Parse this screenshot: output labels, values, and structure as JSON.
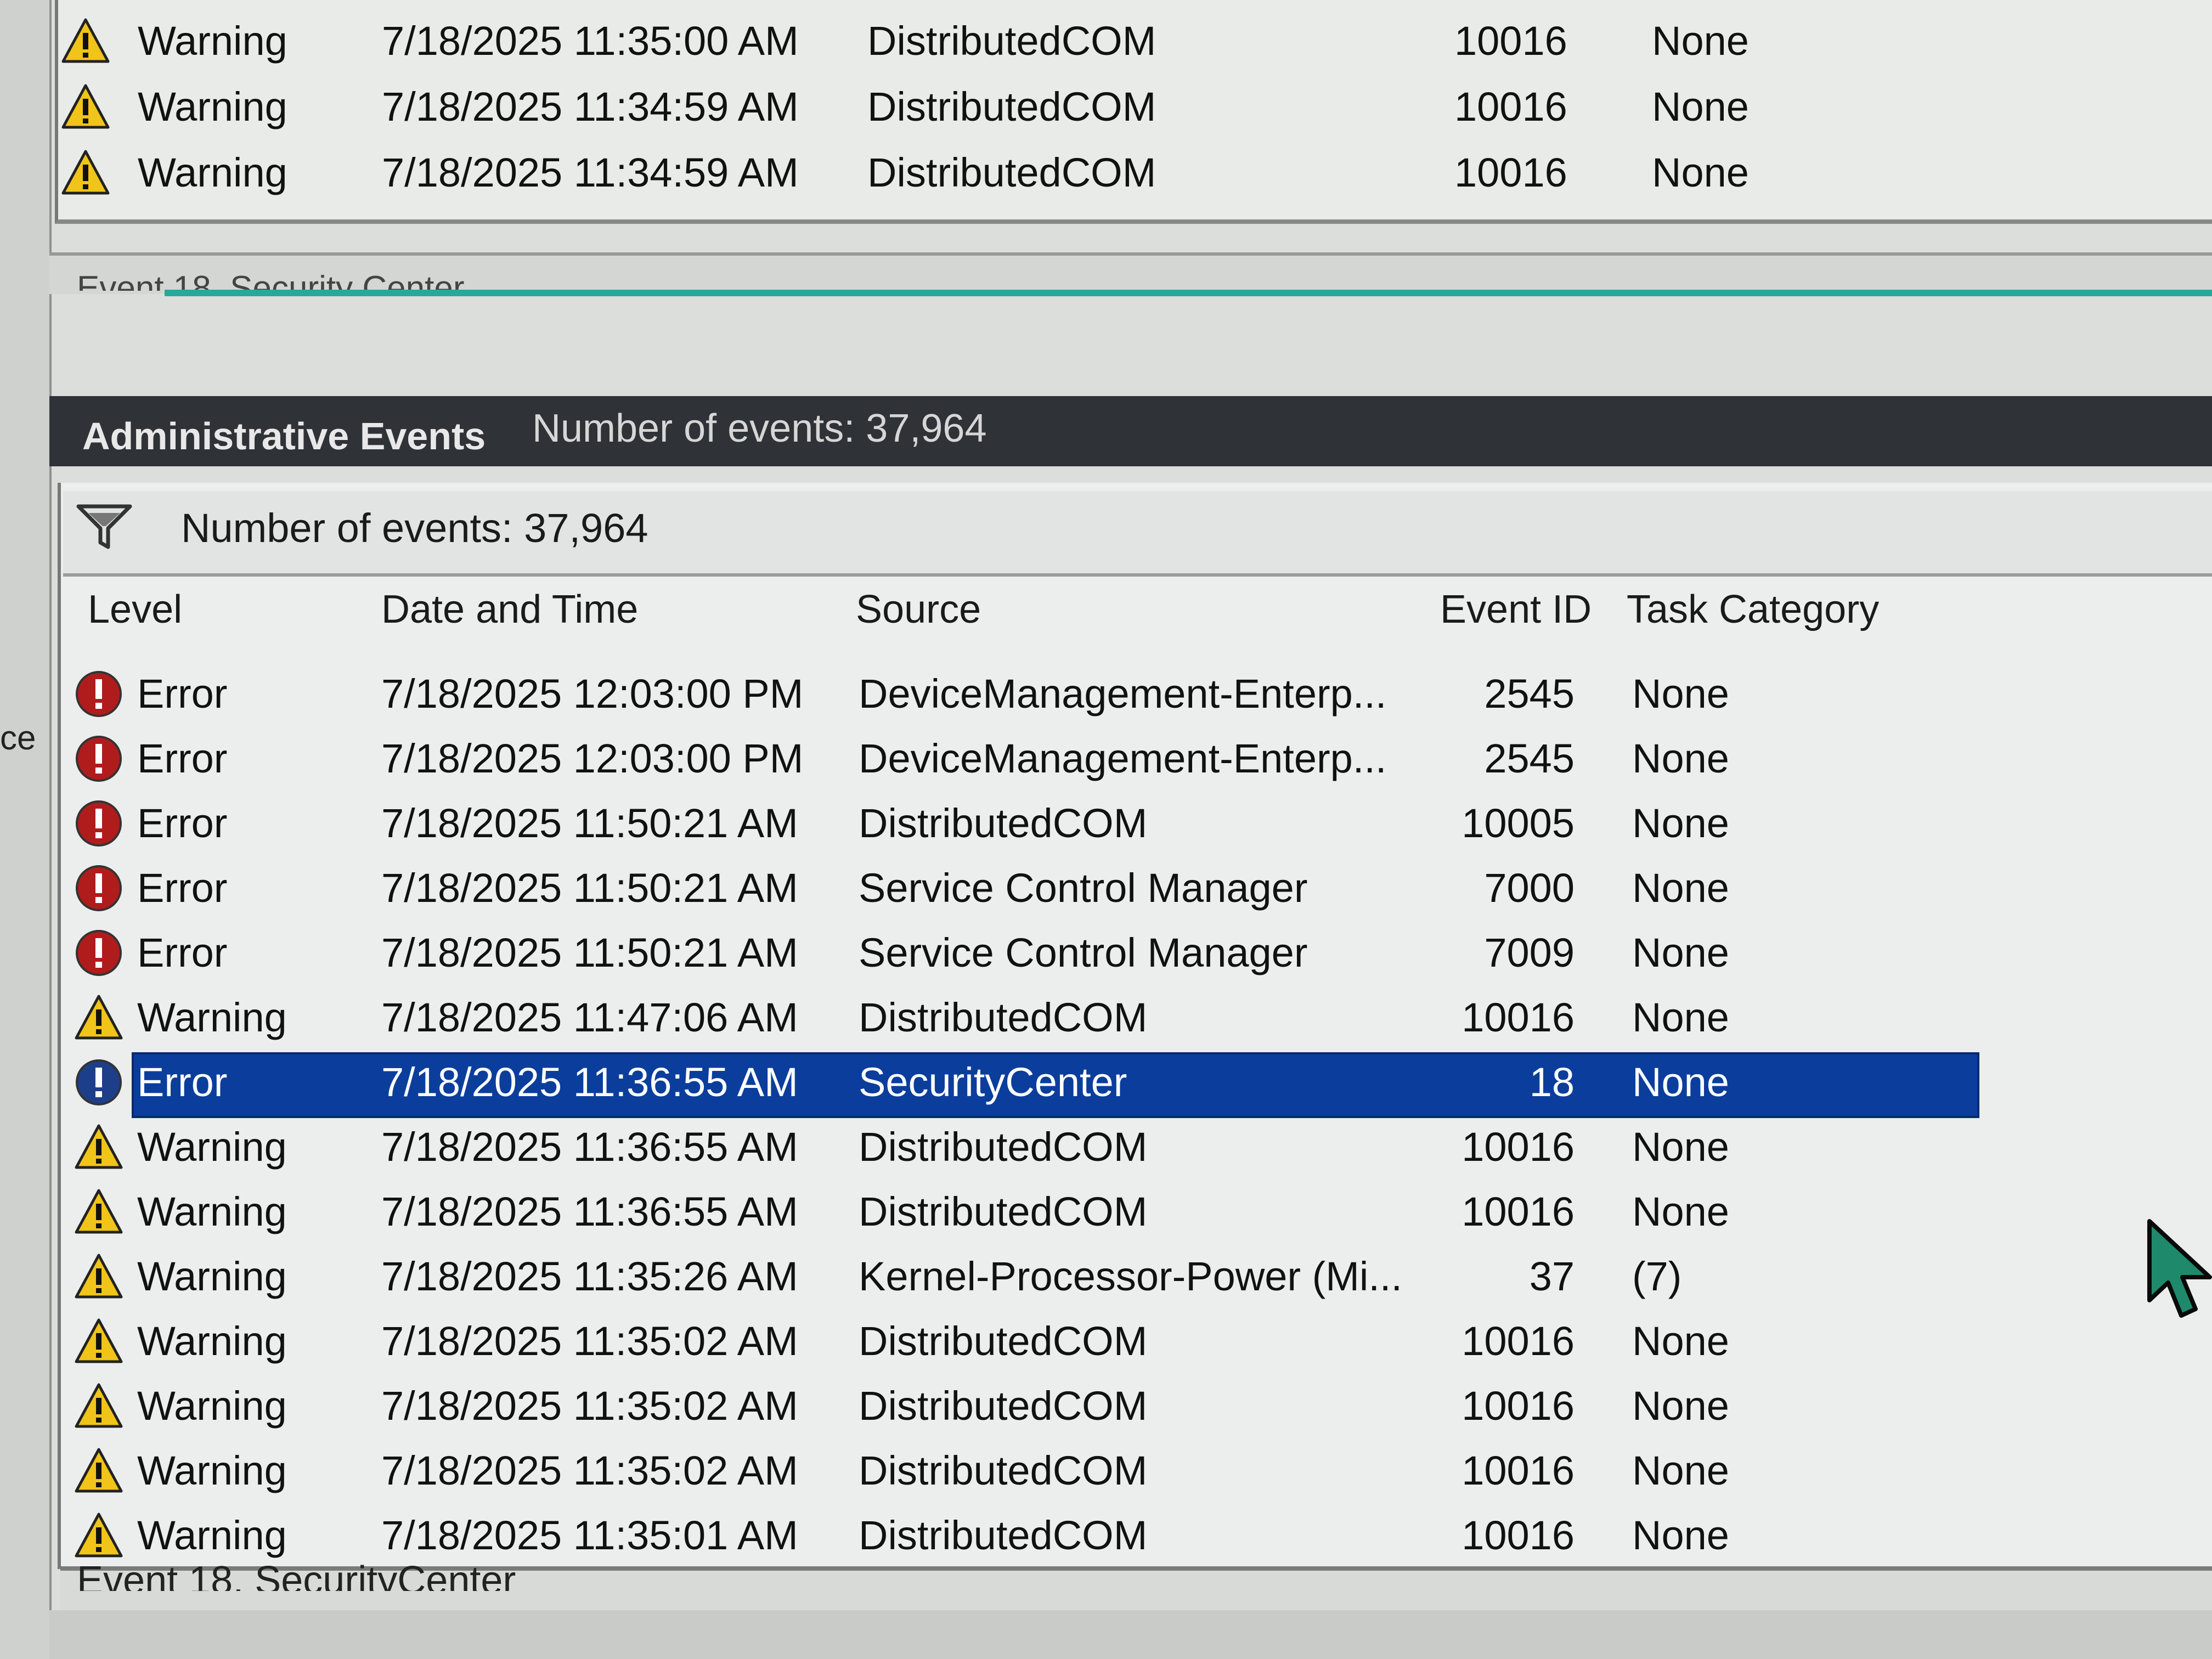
{
  "left_strip": {
    "label": "ce"
  },
  "previous_list": {
    "rows": [
      {
        "level": "Warning",
        "date": "7/18/2025 11:35:00 AM",
        "source": "DistributedCOM",
        "event_id": "10016",
        "task": "None"
      },
      {
        "level": "Warning",
        "date": "7/18/2025 11:34:59 AM",
        "source": "DistributedCOM",
        "event_id": "10016",
        "task": "None"
      },
      {
        "level": "Warning",
        "date": "7/18/2025 11:34:59 AM",
        "source": "DistributedCOM",
        "event_id": "10016",
        "task": "None"
      }
    ],
    "footer_label": "Event 18, Security Center"
  },
  "header": {
    "title": "Administrative Events",
    "count": "Number of events: 37,964"
  },
  "filter": {
    "icon": "filter-icon",
    "text": "Number of events: 37,964"
  },
  "columns": {
    "level": "Level",
    "date": "Date and Time",
    "source": "Source",
    "event_id": "Event ID",
    "task": "Task Category"
  },
  "events": [
    {
      "level": "Error",
      "icon": "error-icon",
      "date": "7/18/2025 12:03:00 PM",
      "source": "DeviceManagement-Enterp...",
      "event_id": "2545",
      "task": "None"
    },
    {
      "level": "Error",
      "icon": "error-icon",
      "date": "7/18/2025 12:03:00 PM",
      "source": "DeviceManagement-Enterp...",
      "event_id": "2545",
      "task": "None"
    },
    {
      "level": "Error",
      "icon": "error-icon",
      "date": "7/18/2025 11:50:21 AM",
      "source": "DistributedCOM",
      "event_id": "10005",
      "task": "None"
    },
    {
      "level": "Error",
      "icon": "error-icon",
      "date": "7/18/2025 11:50:21 AM",
      "source": "Service Control Manager",
      "event_id": "7000",
      "task": "None"
    },
    {
      "level": "Error",
      "icon": "error-icon",
      "date": "7/18/2025 11:50:21 AM",
      "source": "Service Control Manager",
      "event_id": "7009",
      "task": "None"
    },
    {
      "level": "Warning",
      "icon": "warning-icon",
      "date": "7/18/2025 11:47:06 AM",
      "source": "DistributedCOM",
      "event_id": "10016",
      "task": "None"
    },
    {
      "level": "Error",
      "icon": "error-icon",
      "date": "7/18/2025 11:36:55 AM",
      "source": "SecurityCenter",
      "event_id": "18",
      "task": "None",
      "selected": true
    },
    {
      "level": "Warning",
      "icon": "warning-icon",
      "date": "7/18/2025 11:36:55 AM",
      "source": "DistributedCOM",
      "event_id": "10016",
      "task": "None"
    },
    {
      "level": "Warning",
      "icon": "warning-icon",
      "date": "7/18/2025 11:36:55 AM",
      "source": "DistributedCOM",
      "event_id": "10016",
      "task": "None"
    },
    {
      "level": "Warning",
      "icon": "warning-icon",
      "date": "7/18/2025 11:35:26 AM",
      "source": "Kernel-Processor-Power (Mi...",
      "event_id": "37",
      "task": "(7)"
    },
    {
      "level": "Warning",
      "icon": "warning-icon",
      "date": "7/18/2025 11:35:02 AM",
      "source": "DistributedCOM",
      "event_id": "10016",
      "task": "None"
    },
    {
      "level": "Warning",
      "icon": "warning-icon",
      "date": "7/18/2025 11:35:02 AM",
      "source": "DistributedCOM",
      "event_id": "10016",
      "task": "None"
    },
    {
      "level": "Warning",
      "icon": "warning-icon",
      "date": "7/18/2025 11:35:02 AM",
      "source": "DistributedCOM",
      "event_id": "10016",
      "task": "None"
    },
    {
      "level": "Warning",
      "icon": "warning-icon",
      "date": "7/18/2025 11:35:01 AM",
      "source": "DistributedCOM",
      "event_id": "10016",
      "task": "None"
    }
  ],
  "details_label": "Event 18, SecurityCenter",
  "colors": {
    "selection": "#0b3e9c",
    "header_bar": "#2f3236",
    "error_red": "#b01c1c",
    "warning_yellow": "#f0c419",
    "teal": "#2aa79b"
  }
}
